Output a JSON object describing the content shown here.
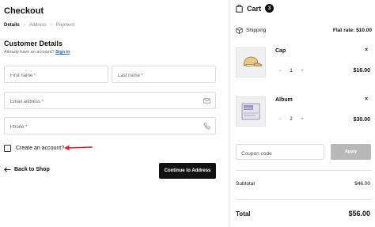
{
  "checkout": {
    "title": "Checkout",
    "breadcrumb": [
      "Details",
      "Address",
      "Payment"
    ],
    "section_title": "Customer Details",
    "account_prompt": "Already have an account?",
    "sign_in_label": "Sign in",
    "first_name_placeholder": "First name *",
    "last_name_placeholder": "Last name *",
    "email_placeholder": "Email address *",
    "phone_placeholder": "Phone *",
    "create_account_label": "Create an account?",
    "create_account_checked": false,
    "back_label": "Back to Shop",
    "continue_label": "Continue to Address"
  },
  "cart": {
    "title": "Cart",
    "count": "3",
    "shipping_label": "Shipping",
    "shipping_rate": "Flat rate: $10.00",
    "items": [
      {
        "name": "Cap",
        "quantity": "1",
        "price": "$16.00",
        "remove": "×",
        "minus": "−",
        "plus": "+",
        "icon": "cap-icon"
      },
      {
        "name": "Album",
        "quantity": "2",
        "price": "$30.00",
        "remove": "×",
        "minus": "−",
        "plus": "+",
        "icon": "album-icon"
      }
    ],
    "coupon_placeholder": "Coupon code",
    "apply_label": "Apply",
    "subtotal_label": "Subtotal",
    "subtotal_value": "$46.00",
    "total_label": "Total",
    "total_value": "$56.00"
  },
  "colors": {
    "accent_link": "#1a64c8",
    "annotation_arrow": "#d9262a",
    "primary_button": "#111111",
    "disabled_button": "#b8b8b8"
  }
}
